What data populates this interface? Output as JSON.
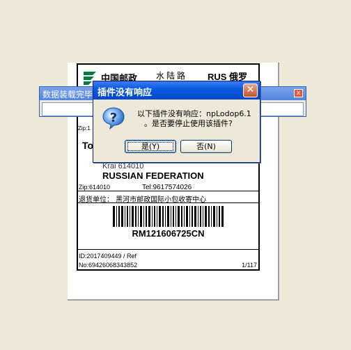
{
  "background_window": {
    "title": "数据装载完毕",
    "close_glyph": "x"
  },
  "label": {
    "carrier": "中国邮政",
    "service": "水陆路",
    "country_code": "RUS 俄罗",
    "zip_partial": "Zip:1",
    "to_prefix": "To",
    "region": "Krai 614010",
    "country": "RUSSIAN FEDERATION",
    "zip": "Zip:614010",
    "tel": "Tel:9617574026",
    "return_address": "退货单位：  黑河市邮政国际小包收寄中心",
    "tracking_number": "RM121606725CN",
    "id_line": "ID:2017409449 / Ref",
    "no_line": "No:69426068343852",
    "page_counter": "1/117"
  },
  "dialog": {
    "title": "插件没有响应",
    "close_glyph": "✕",
    "message_line1": "以下插件没有响应：npLodop6.1",
    "message_line2": "。是否要停止使用该插件?",
    "yes_label": "是(Y)",
    "no_label": "否(N)"
  },
  "colors": {
    "dialog_title_bar": "#0a5ae0",
    "desktop_background": "#ece9d8"
  },
  "icons": {
    "dialog": "question-icon",
    "label": "china-post-logo-icon"
  }
}
